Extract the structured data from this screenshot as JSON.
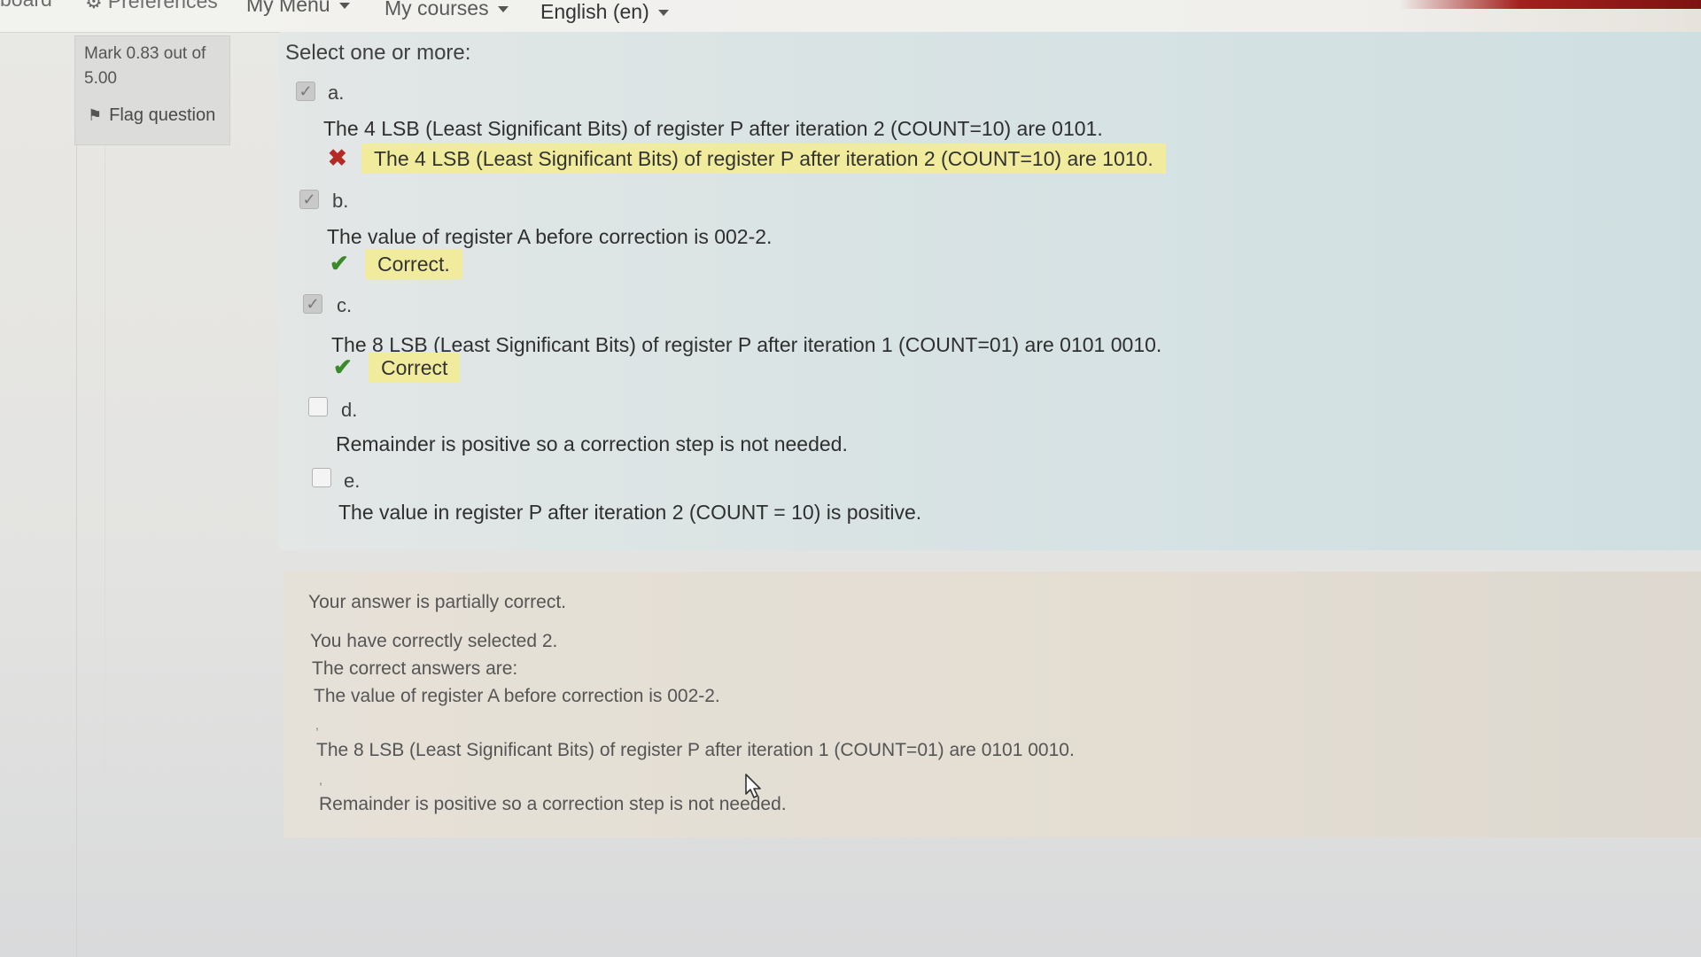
{
  "navbar": {
    "dashboard": "board",
    "preferences": "Preferences",
    "my_menu": "My Menu",
    "my_courses": "My courses",
    "language": "English (en)"
  },
  "info": {
    "mark": "Mark 0.83 out of 5.00",
    "flag_label": "Flag question"
  },
  "question": {
    "prompt": "Select one or more:",
    "options": [
      {
        "letter": "a.",
        "text": "The 4 LSB (Least Significant Bits) of register P after iteration 2 (COUNT=10) are 0101.",
        "checked": true,
        "feedback": "The 4 LSB (Least Significant Bits) of register P after iteration 2 (COUNT=10) are 1010.",
        "result": "wrong"
      },
      {
        "letter": "b.",
        "text": "The value of register A before correction is 002-2.",
        "checked": true,
        "feedback": "Correct.",
        "result": "right"
      },
      {
        "letter": "c.",
        "text": "The 8 LSB (Least Significant Bits) of register P after iteration 1 (COUNT=01) are 0101 0010.",
        "checked": true,
        "feedback": "Correct",
        "result": "right"
      },
      {
        "letter": "d.",
        "text": "Remainder is positive so a correction step is not needed.",
        "checked": false
      },
      {
        "letter": "e.",
        "text": "The value in register P after iteration 2 (COUNT = 10) is positive.",
        "checked": false
      }
    ]
  },
  "outcome": {
    "summary": "Your answer is partially correct.",
    "selected": "You have correctly selected 2.",
    "correct_intro": "The correct answers are:",
    "answer1": "The value of register A before correction is 002-2.",
    "sep1": ",",
    "answer2": "The 8 LSB (Least Significant Bits) of register P after iteration 1 (COUNT=01) are 0101 0010.",
    "sep2": ",",
    "answer3": "Remainder is positive so a correction step is not needed."
  },
  "icons": {
    "check_mark": "check-icon",
    "cross_mark": "cross-icon",
    "flag": "flag-icon",
    "gear": "gear-icon"
  },
  "colors": {
    "feedback_highlight": "#f1ec9d",
    "wrong": "#b52a24",
    "right": "#3a8a2a",
    "formulation_bg": "#d9e3e4",
    "outcome_bg": "#e3ddd2"
  }
}
